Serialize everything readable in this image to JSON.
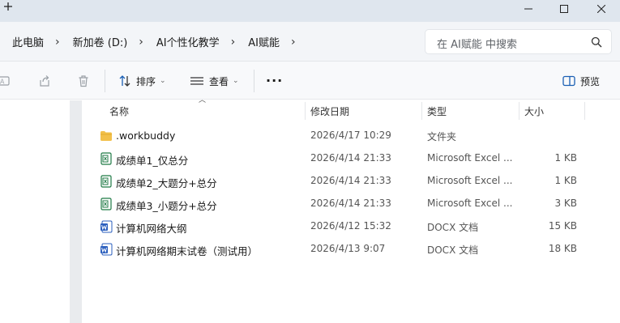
{
  "titlebar": {
    "new_tab_icon": "plus-icon",
    "minimize_icon": "minimize-icon",
    "maximize_icon": "maximize-icon",
    "close_icon": "close-icon"
  },
  "address": {
    "crumbs": [
      "此电脑",
      "新加卷 (D:)",
      "AI个性化教学",
      "AI赋能"
    ],
    "separator": "›"
  },
  "search": {
    "placeholder": "在 AI赋能 中搜索"
  },
  "toolbar": {
    "sort_label": "排序",
    "view_label": "查看",
    "more_label": "···",
    "preview_label": "预览"
  },
  "columns": {
    "name": "名称",
    "date": "修改日期",
    "type": "类型",
    "size": "大小"
  },
  "files": [
    {
      "name": ".workbuddy",
      "date": "2026/4/17 10:29",
      "type": "文件夹",
      "size": "",
      "icon": "folder-icon"
    },
    {
      "name": "成绩单1_仅总分",
      "date": "2026/4/14 21:33",
      "type": "Microsoft Excel ...",
      "size": "1 KB",
      "icon": "csv-file-icon"
    },
    {
      "name": "成绩单2_大题分+总分",
      "date": "2026/4/14 21:33",
      "type": "Microsoft Excel ...",
      "size": "1 KB",
      "icon": "csv-file-icon"
    },
    {
      "name": "成绩单3_小题分+总分",
      "date": "2026/4/14 21:33",
      "type": "Microsoft Excel ...",
      "size": "3 KB",
      "icon": "csv-file-icon"
    },
    {
      "name": "计算机网络大纲",
      "date": "2026/4/12 15:32",
      "type": "DOCX 文档",
      "size": "15 KB",
      "icon": "word-file-icon"
    },
    {
      "name": "计算机网络期末试卷（测试用）",
      "date": "2026/4/13 9:07",
      "type": "DOCX 文档",
      "size": "18 KB",
      "icon": "word-file-icon"
    }
  ],
  "colors": {
    "accent": "#1a5fb4",
    "folder": "#f2c04a",
    "excel": "#1f7a45",
    "word": "#2b5fbe"
  }
}
